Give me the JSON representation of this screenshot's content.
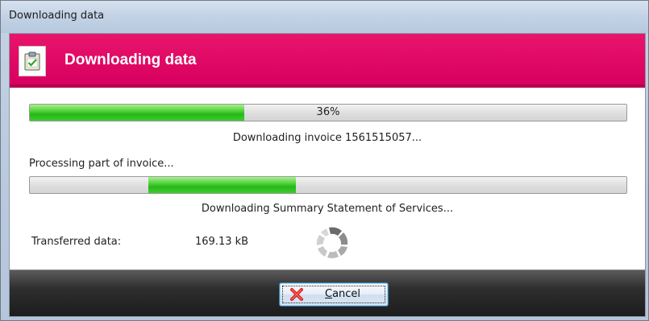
{
  "window": {
    "title": "Downloading data"
  },
  "banner": {
    "title": "Downloading data",
    "icon": "clipboard-check-icon"
  },
  "main_progress": {
    "percent": 36,
    "label": "36%"
  },
  "status_invoice": "Downloading invoice 1561515057...",
  "processing_label": "Processing part of invoice...",
  "secondary_progress": {
    "mode": "indeterminate"
  },
  "status_summary": "Downloading Summary Statement of Services...",
  "transfer": {
    "label": "Transferred data:",
    "value": "169.13 kB"
  },
  "spinner": {
    "icon": "loading-spinner-icon"
  },
  "footer": {
    "cancel_button": {
      "label_mnemonic": "C",
      "label_rest": "ancel",
      "icon": "red-x-icon"
    }
  },
  "colors": {
    "banner": "#d8005f",
    "progress_fill": "#27b71a",
    "footer": "#1c1c1c"
  }
}
